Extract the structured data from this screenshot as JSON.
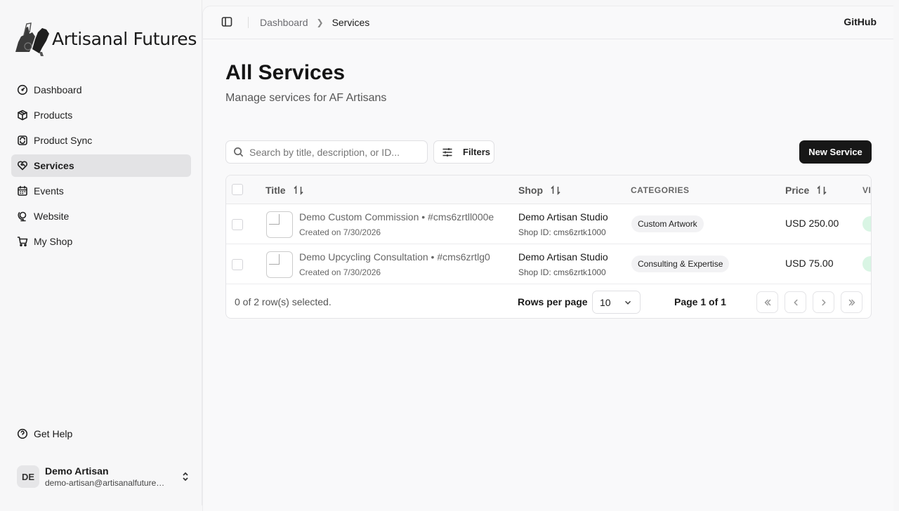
{
  "brand": {
    "name": "Artisanal Futures"
  },
  "sidebar": {
    "items": [
      {
        "label": "Dashboard",
        "icon": "gauge-icon",
        "active": false
      },
      {
        "label": "Products",
        "icon": "package-icon",
        "active": false
      },
      {
        "label": "Product Sync",
        "icon": "sync-icon",
        "active": false
      },
      {
        "label": "Services",
        "icon": "heart-handshake-icon",
        "active": true
      },
      {
        "label": "Events",
        "icon": "calendar-icon",
        "active": false
      },
      {
        "label": "Website",
        "icon": "globe-stand-icon",
        "active": false
      },
      {
        "label": "My Shop",
        "icon": "shopping-cart-icon",
        "active": false
      }
    ],
    "help": "Get Help",
    "user": {
      "initials": "DE",
      "name": "Demo Artisan",
      "email": "demo-artisan@artisanalfutures.org"
    }
  },
  "header": {
    "breadcrumb": [
      "Dashboard",
      "Services"
    ],
    "github": "GitHub"
  },
  "page": {
    "title": "All Services",
    "subtitle": "Manage services for AF Artisans"
  },
  "toolbar": {
    "search_placeholder": "Search by title, description, or ID...",
    "filters_label": "Filters",
    "new_label": "New Service"
  },
  "table": {
    "columns": {
      "title": "Title",
      "shop": "Shop",
      "categories": "CATEGORIES",
      "price": "Price",
      "visibility": "VI"
    },
    "rows": [
      {
        "title": "Demo Custom Commission • #cms6zrtll000e",
        "created": "Created on 7/30/2026",
        "shop": "Demo Artisan Studio",
        "shop_id": "Shop ID: cms6zrtk1000",
        "category": "Custom Artwork",
        "price": "USD 250.00"
      },
      {
        "title": "Demo Upcycling Consultation • #cms6zrtlg0",
        "created": "Created on 7/30/2026",
        "shop": "Demo Artisan Studio",
        "shop_id": "Shop ID: cms6zrtk1000",
        "category": "Consulting & Expertise",
        "price": "USD 75.00"
      }
    ],
    "footer": {
      "selected": "0 of 2 row(s) selected.",
      "rows_per_page_label": "Rows per page",
      "rows_per_page": "10",
      "page_label": "Page 1 of 1"
    }
  },
  "colors": {
    "accent": "#171717",
    "active_nav": "#e3e3e5",
    "visibility_badge": "#d9f5e4"
  }
}
